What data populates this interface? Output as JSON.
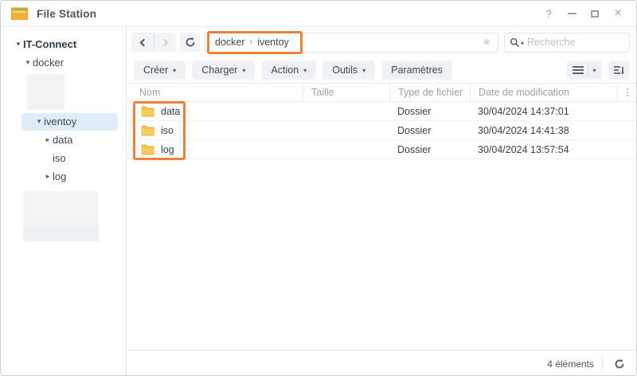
{
  "window": {
    "title": "File Station",
    "controls": {
      "help": "?",
      "close": "×"
    }
  },
  "sidebar": {
    "items": [
      {
        "label": "IT-Connect",
        "state": "expanded",
        "selected": false
      },
      {
        "label": "docker",
        "state": "expanded",
        "selected": false
      },
      {
        "label": "iventoy",
        "state": "expanded",
        "selected": true
      },
      {
        "label": "data",
        "state": "collapsed",
        "selected": false
      },
      {
        "label": "iso",
        "state": "none",
        "selected": false
      },
      {
        "label": "log",
        "state": "collapsed",
        "selected": false
      }
    ]
  },
  "nav": {
    "path": {
      "root": "docker",
      "separator": "›",
      "current": "iventoy"
    },
    "search_placeholder": "Recherche"
  },
  "toolbar": {
    "buttons": [
      {
        "label": "Créer",
        "dropdown": true
      },
      {
        "label": "Charger",
        "dropdown": true
      },
      {
        "label": "Action",
        "dropdown": true
      },
      {
        "label": "Outils",
        "dropdown": true
      },
      {
        "label": "Paramètres",
        "dropdown": false
      }
    ]
  },
  "table": {
    "columns": [
      "Nom",
      "Taille",
      "Type de fichier",
      "Date de modification"
    ],
    "rows": [
      {
        "name": "data",
        "size": "",
        "type": "Dossier",
        "date": "30/04/2024 14:37:01"
      },
      {
        "name": "iso",
        "size": "",
        "type": "Dossier",
        "date": "30/04/2024 14:41:38"
      },
      {
        "name": "log",
        "size": "",
        "type": "Dossier",
        "date": "30/04/2024 13:57:54"
      }
    ]
  },
  "statusbar": {
    "items_count": "4 éléments"
  },
  "colors": {
    "annotation_orange": "#e8813a",
    "selection_blue": "#dfecf9",
    "folder_yellow": "#f3c14d"
  }
}
